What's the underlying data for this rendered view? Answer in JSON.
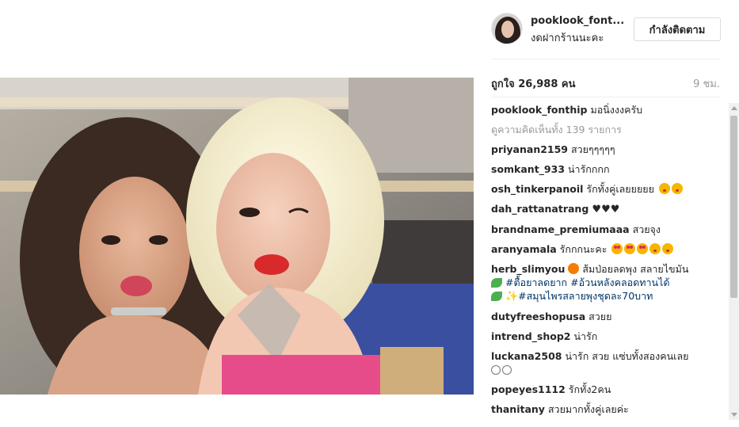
{
  "post": {
    "username": "pooklook_font...",
    "location": "งดฝากร้านนะคะ",
    "follow_label": "กำลังติดตาม",
    "likes": "ถูกใจ 26,988 คน",
    "time": "9 ชม."
  },
  "caption": {
    "user": "pooklook_fonthip",
    "text": " มอนิ่งงงครับ"
  },
  "view_all": "ดูความคิดเห็นทั้ง 139 รายการ",
  "comments": [
    {
      "user": "priyanan2159",
      "text": " สวยๆๆๆๆๆ"
    },
    {
      "user": "somkant_933",
      "text": " น่ารักกกก"
    },
    {
      "user": "osh_tinkerpanoil",
      "text": " รักทั้งคู่เลยยยยย"
    },
    {
      "user": "dah_rattanatrang",
      "text": " ♥♥♥"
    },
    {
      "user": "brandname_premiumaaa",
      "text": " สวยจุง"
    },
    {
      "user": "aranyamala",
      "text": " รักกกนะคะ"
    },
    {
      "user": "herb_slimyou",
      "text": " ส้มป่อยลดพุง สลายไขมัน"
    },
    {
      "user": "dutyfreeshopusa",
      "text": " สวยย"
    },
    {
      "user": "intrend_shop2",
      "text": " น่ารัก"
    },
    {
      "user": "luckana2508",
      "text": " น่ารัก สวย แซ่บทั้งสองคนเลย"
    },
    {
      "user": "popeyes1112",
      "text": " รักทั้ง2คน"
    },
    {
      "user": "thanitany",
      "text": " สวยมากทั้งคู่เลยค่ะ"
    }
  ],
  "hashtags": {
    "line1": "#ตื้อยาลดยาก #อ้วนหลังคลอดทานได้",
    "line2": "#สมุนไพรสลายพุงชุดละ70บาท"
  },
  "icons": {
    "avatar": "profile-avatar",
    "scroll_up": "scroll-up-icon",
    "scroll_down": "scroll-down-icon"
  },
  "colors": {
    "text": "#262626",
    "muted": "#999999",
    "hashtag": "#003569",
    "divider": "#efefef"
  }
}
